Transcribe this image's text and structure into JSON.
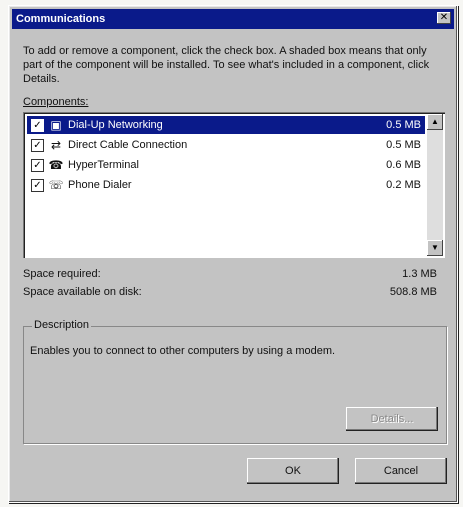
{
  "window": {
    "title": "Communications",
    "close_glyph": "✕"
  },
  "intro_text": "To add or remove a component, click the check box. A shaded box means that only part of the component will be installed. To see what's included in a component, click Details.",
  "components_label": "Components:",
  "components": [
    {
      "name": "Dial-Up Networking",
      "size": "0.5 MB",
      "checked": true,
      "icon": "dialup-icon",
      "glyph": "▣"
    },
    {
      "name": "Direct Cable Connection",
      "size": "0.5 MB",
      "checked": true,
      "icon": "cable-icon",
      "glyph": "⇄"
    },
    {
      "name": "HyperTerminal",
      "size": "0.6 MB",
      "checked": true,
      "icon": "hyperterminal-icon",
      "glyph": "☎"
    },
    {
      "name": "Phone Dialer",
      "size": "0.2 MB",
      "checked": true,
      "icon": "phone-dialer-icon",
      "glyph": "☏"
    }
  ],
  "space": {
    "required_label": "Space required:",
    "required_value": "1.3 MB",
    "available_label": "Space available on disk:",
    "available_value": "508.8 MB"
  },
  "description": {
    "legend": "Description",
    "text": "Enables you to connect to other computers by using a modem.",
    "details_button": "Details..."
  },
  "buttons": {
    "ok": "OK",
    "cancel": "Cancel"
  },
  "scrollbar": {
    "up_glyph": "▲",
    "down_glyph": "▼"
  },
  "colors": {
    "titlebar": "#0a1a8a",
    "selection": "#0a1a8a",
    "face": "#c3c3c3"
  }
}
